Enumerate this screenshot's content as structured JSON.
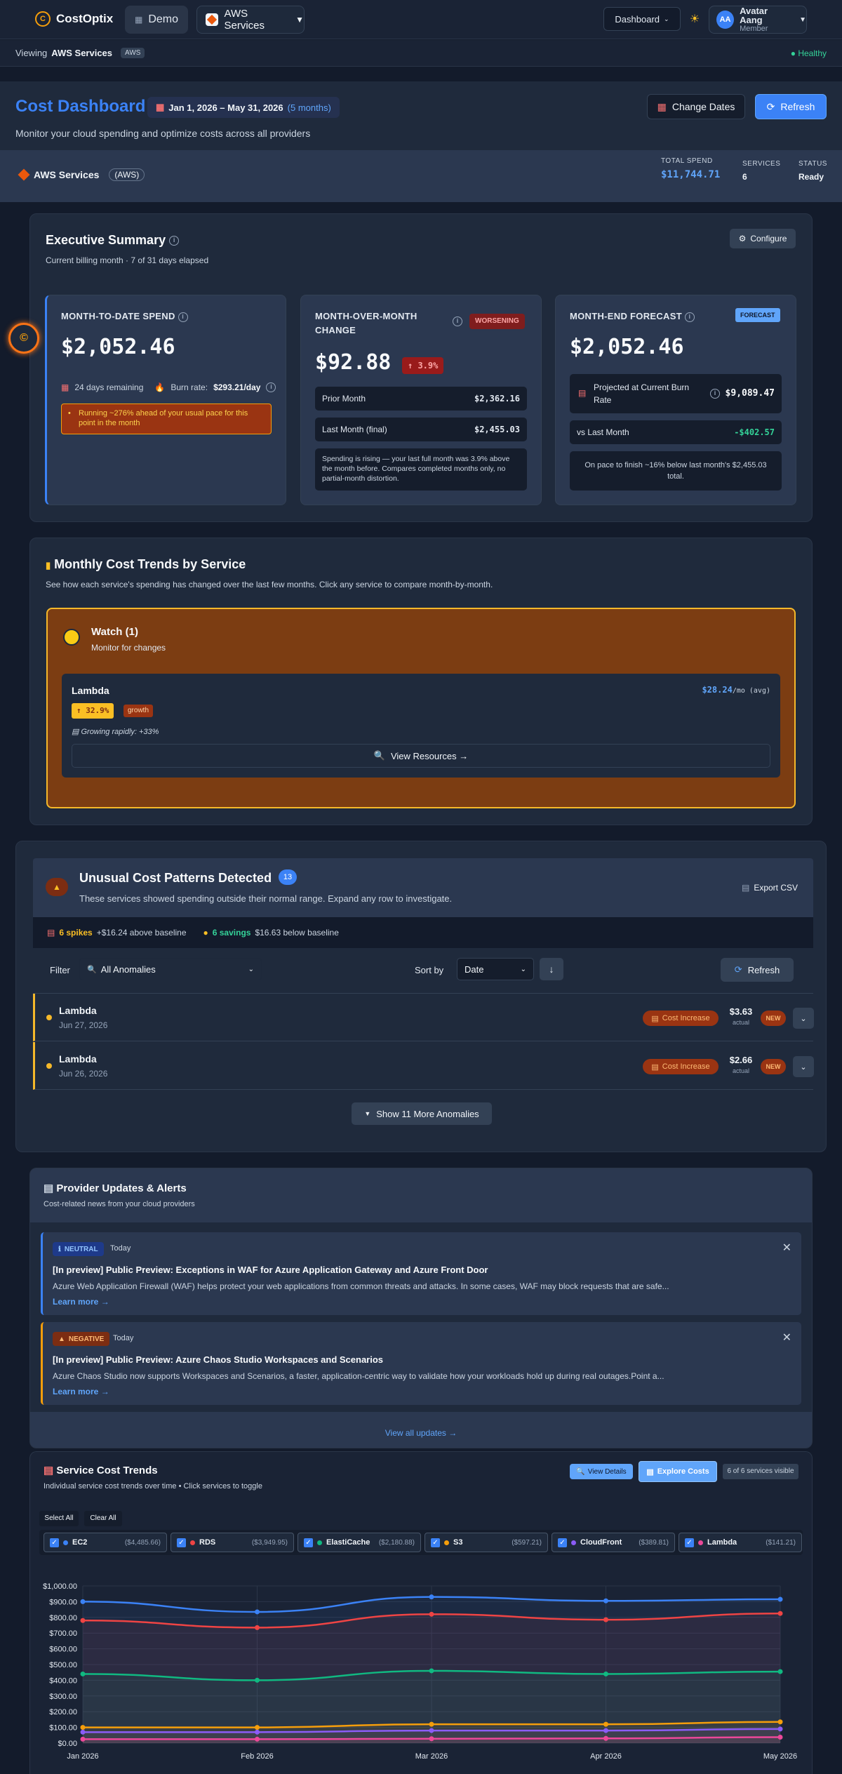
{
  "topbar": {
    "app_name": "CostOptix",
    "logo_letter": "C",
    "demo_label": "Demo",
    "provider_label": "AWS Services",
    "dashboard_label": "Dashboard",
    "user_initials": "AA",
    "user_name": "Avatar Aang",
    "user_role": "Member"
  },
  "viewbar": {
    "prefix": "Viewing",
    "provider": "AWS Services",
    "tag": "AWS",
    "status": "Healthy"
  },
  "header": {
    "title": "Cost Dashboard",
    "date_range": "Jan 1, 2026 – May 31, 2026",
    "months": "(5 months)",
    "subtitle": "Monitor your cloud spending and optimize costs across all providers",
    "change_dates": "Change Dates",
    "refresh": "Refresh"
  },
  "service_bar": {
    "name": "AWS Services",
    "tag": "(AWS)",
    "total_label": "TOTAL SPEND",
    "total_value": "$11,744.71",
    "services_label": "SERVICES",
    "services_value": "6",
    "status_label": "STATUS",
    "status_value": "Ready"
  },
  "exec": {
    "title": "Executive Summary",
    "subtitle": "Current billing month · 7 of 31 days elapsed",
    "configure": "Configure",
    "mtd": {
      "label": "MONTH-TO-DATE SPEND",
      "value": "$2,052.46",
      "remaining": "24 days remaining",
      "burn_label": "Burn rate:",
      "burn_value": "$293.21/day",
      "warning": "Running ~276% ahead of your usual pace for this point in the month"
    },
    "mom": {
      "label": "MONTH-OVER-MONTH CHANGE",
      "badge": "WORSENING",
      "value": "$92.88",
      "pct": "↑ 3.9%",
      "prior_label": "Prior Month",
      "prior_value": "$2,362.16",
      "last_label": "Last Month (final)",
      "last_value": "$2,455.03",
      "note": "Spending is rising — your last full month was 3.9% above the month before. Compares completed months only, no partial-month distortion."
    },
    "forecast": {
      "label": "MONTH-END FORECAST",
      "badge": "FORECAST",
      "value": "$2,052.46",
      "proj_label": "Projected at Current Burn Rate",
      "proj_value": "$9,089.47",
      "vs_label": "vs Last Month",
      "vs_value": "-$402.57",
      "note": "On pace to finish ~16% below last month's $2,455.03 total."
    }
  },
  "trends": {
    "title": "Monthly Cost Trends by Service",
    "subtitle": "See how each service's spending has changed over the last few months. Click any service to compare month-by-month.",
    "watch_title": "Watch (1)",
    "watch_sub": "Monitor for changes",
    "svc_name": "Lambda",
    "svc_value": "$28.24",
    "svc_unit": "/mo (avg)",
    "svc_pct": "↑ 32.9%",
    "svc_tag": "growth",
    "svc_note": "Growing rapidly: +33%",
    "view_resources": "View Resources →"
  },
  "anomalies": {
    "title": "Unusual Cost Patterns Detected",
    "count": "13",
    "subtitle": "These services showed spending outside their normal range. Expand any row to investigate.",
    "export": "Export CSV",
    "spikes": "6 spikes",
    "spikes_detail": "+$16.24 above baseline",
    "savings": "6 savings",
    "savings_detail": "$16.63 below baseline",
    "filter_label": "Filter",
    "filter_value": "All Anomalies",
    "sort_label": "Sort by",
    "sort_value": "Date",
    "refresh": "Refresh",
    "rows": [
      {
        "name": "Lambda",
        "date": "Jun 27, 2026",
        "type": "Cost Increase",
        "amount": "$3.63",
        "amount_label": "actual",
        "badge": "NEW"
      },
      {
        "name": "Lambda",
        "date": "Jun 26, 2026",
        "type": "Cost Increase",
        "amount": "$2.66",
        "amount_label": "actual",
        "badge": "NEW"
      }
    ],
    "show_more": "Show 11 More Anomalies"
  },
  "updates": {
    "title": "Provider Updates & Alerts",
    "subtitle": "Cost-related news from your cloud providers",
    "view_all": "View all updates →",
    "items": [
      {
        "tag": "NEUTRAL",
        "when": "Today",
        "title": "[In preview] Public Preview: Exceptions in WAF for Azure Application Gateway and Azure Front Door",
        "body": "Azure Web Application Firewall (WAF) helps protect your web applications from common threats and attacks. In some cases, WAF may block requests that are safe...",
        "link": "Learn more →"
      },
      {
        "tag": "NEGATIVE",
        "when": "Today",
        "title": "[In preview] Public Preview: Azure Chaos Studio Workspaces and Scenarios",
        "body": "Azure Chaos Studio now supports Workspaces and Scenarios, a faster, application-centric way to validate how your workloads hold up during real outages.Point a...",
        "link": "Learn more →"
      }
    ]
  },
  "svc_trends": {
    "title": "Service Cost Trends",
    "subtitle": "Individual service cost trends over time • Click services to toggle",
    "view_details": "View Details",
    "explore": "Explore Costs",
    "visible": "6 of 6 services visible",
    "select_all": "Select All",
    "clear_all": "Clear All",
    "toggles": [
      {
        "name": "EC2",
        "total": "($4,485.66)",
        "color": "#3b82f6"
      },
      {
        "name": "RDS",
        "total": "($3,949.95)",
        "color": "#ef4444"
      },
      {
        "name": "ElastiCache",
        "total": "($2,180.88)",
        "color": "#10b981"
      },
      {
        "name": "S3",
        "total": "($597.21)",
        "color": "#f59e0b"
      },
      {
        "name": "CloudFront",
        "total": "($389.81)",
        "color": "#8b5cf6"
      },
      {
        "name": "Lambda",
        "total": "($141.21)",
        "color": "#ec4899"
      }
    ]
  },
  "chart_data": {
    "type": "area",
    "x": [
      "Jan 2026",
      "Feb 2026",
      "Mar 2026",
      "Apr 2026",
      "May 2026"
    ],
    "ylim": [
      0,
      1000
    ],
    "yticks": [
      "$0.00",
      "$100.00",
      "$200.00",
      "$300.00",
      "$400.00",
      "$500.00",
      "$600.00",
      "$700.00",
      "$800.00",
      "$900.00",
      "$1,000.00"
    ],
    "grid": true,
    "series": [
      {
        "name": "EC2",
        "color": "#3b82f6",
        "values": [
          900,
          835,
          930,
          905,
          915
        ]
      },
      {
        "name": "RDS",
        "color": "#ef4444",
        "values": [
          780,
          735,
          820,
          785,
          825
        ]
      },
      {
        "name": "ElastiCache",
        "color": "#10b981",
        "values": [
          440,
          400,
          460,
          440,
          455
        ]
      },
      {
        "name": "S3",
        "color": "#f59e0b",
        "values": [
          100,
          100,
          120,
          120,
          135
        ]
      },
      {
        "name": "CloudFront",
        "color": "#8b5cf6",
        "values": [
          70,
          70,
          80,
          80,
          90
        ]
      },
      {
        "name": "Lambda",
        "color": "#ec4899",
        "values": [
          25,
          25,
          28,
          30,
          38
        ]
      }
    ]
  }
}
